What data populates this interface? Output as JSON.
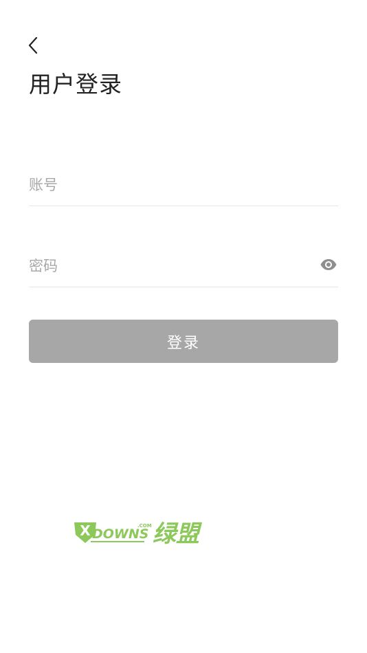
{
  "header": {
    "back_icon": "chevron-left-icon",
    "title": "用户登录"
  },
  "form": {
    "account": {
      "placeholder": "账号",
      "value": ""
    },
    "password": {
      "placeholder": "密码",
      "value": "",
      "toggle_icon": "eye-icon"
    },
    "login_label": "登录"
  },
  "watermark": {
    "brand_text": "DOWNS绿盟",
    "badge_letter": "X",
    "tld": ".COM"
  },
  "colors": {
    "background": "#ffffff",
    "title": "#222222",
    "placeholder": "#a8a8a8",
    "divider": "#e6e6e6",
    "button_bg": "#a8a7a8",
    "button_text": "#ffffff",
    "icon": "#8e8e8e",
    "watermark_green": "#8cc85a"
  }
}
